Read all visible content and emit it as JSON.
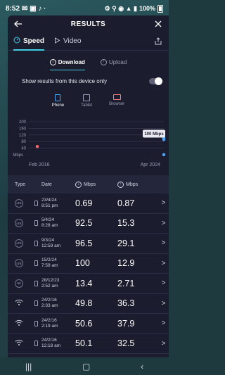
{
  "status": {
    "time": "8:52",
    "battery": "100%"
  },
  "header": {
    "title": "RESULTS"
  },
  "tabs": [
    {
      "label": "Speed",
      "active": true
    },
    {
      "label": "Video",
      "active": false
    }
  ],
  "subtabs": [
    {
      "label": "Download",
      "active": true
    },
    {
      "label": "Upload",
      "active": false
    }
  ],
  "filter": {
    "label": "Show results from this device only",
    "enabled": false
  },
  "devices": [
    {
      "label": "Phone",
      "active": true
    },
    {
      "label": "Tablet",
      "active": false
    },
    {
      "label": "Browser",
      "active": false
    }
  ],
  "chart_data": {
    "type": "scatter",
    "title": "",
    "ylabel": "Mbps",
    "y_ticks": [
      "200",
      "160",
      "120",
      "80",
      "40"
    ],
    "ylim": [
      0,
      200
    ],
    "x_start_label": "Feb 2016",
    "x_end_label": "Apr 2024",
    "tooltip": "100 Mbps",
    "points": [
      {
        "date": "2016-02-24",
        "value": 50.1,
        "color": "#ff6b6b"
      },
      {
        "date": "2024-04-23",
        "value": 100,
        "color": "#4aa8ff"
      },
      {
        "date": "2024-04-23",
        "value": 92.5,
        "color": "#4aa8ff"
      },
      {
        "date": "2024-04-23",
        "value": 0.69,
        "color": "#4aa8ff"
      }
    ]
  },
  "table": {
    "headers": {
      "type": "Type",
      "date": "Date",
      "download": "Mbps",
      "upload": "Mbps"
    },
    "rows": [
      {
        "type": "LTE",
        "date": "23/4/24",
        "time": "8:51 pm",
        "download": "0.69",
        "upload": "0.87",
        "wifi": false
      },
      {
        "type": "LTE",
        "date": "5/4/24",
        "time": "8:28 am",
        "download": "92.5",
        "upload": "15.3",
        "wifi": false
      },
      {
        "type": "LTE",
        "date": "9/3/24",
        "time": "12:59 am",
        "download": "96.5",
        "upload": "29.1",
        "wifi": false
      },
      {
        "type": "LTE",
        "date": "15/2/24",
        "time": "7:59 am",
        "download": "100",
        "upload": "12.9",
        "wifi": false
      },
      {
        "type": "3G",
        "date": "28/12/23",
        "time": "2:52 am",
        "download": "13.4",
        "upload": "2.71",
        "wifi": false
      },
      {
        "type": "wifi",
        "date": "24/2/16",
        "time": "2:33 am",
        "download": "49.8",
        "upload": "36.3",
        "wifi": true
      },
      {
        "type": "wifi",
        "date": "24/2/16",
        "time": "2:19 am",
        "download": "50.6",
        "upload": "37.9",
        "wifi": true
      },
      {
        "type": "wifi",
        "date": "24/2/16",
        "time": "12:18 am",
        "download": "50.1",
        "upload": "32.5",
        "wifi": true
      }
    ]
  },
  "colors": {
    "accent": "#3fd0e6",
    "panel": "#1b1d2e",
    "phone": "#4aa8ff",
    "browser": "#ff7a7a"
  }
}
